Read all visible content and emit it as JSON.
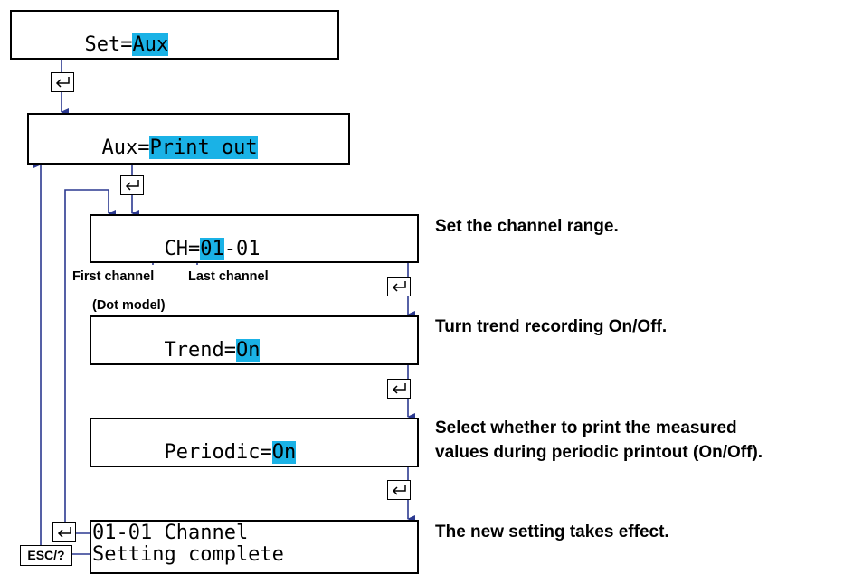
{
  "screens": {
    "set": {
      "prefix": "Set=",
      "value": "Aux"
    },
    "aux": {
      "prefix": "Aux=",
      "value": "Print out"
    },
    "ch": {
      "prefix": "CH=",
      "first": "01",
      "sep": "-",
      "last": "01"
    },
    "trend": {
      "prefix": "Trend=",
      "value": "On"
    },
    "periodic": {
      "prefix": "Periodic=",
      "value": "On"
    },
    "complete": {
      "line1": "01-01 Channel",
      "line2": "Setting complete"
    }
  },
  "labels": {
    "first_channel": "First channel",
    "last_channel": "Last channel",
    "dot_model": "(Dot model)",
    "esc_key": "ESC/?"
  },
  "descriptions": {
    "ch": "Set the channel range.",
    "trend": "Turn trend recording On/Off.",
    "periodic_line1": "Select whether to print the measured",
    "periodic_line2": "values during periodic printout (On/Off).",
    "complete": "The new setting takes effect."
  },
  "colors": {
    "highlight": "#1ab2e6",
    "arrow": "#2b3990"
  },
  "icons": {
    "enter_key": "enter-return-icon"
  }
}
